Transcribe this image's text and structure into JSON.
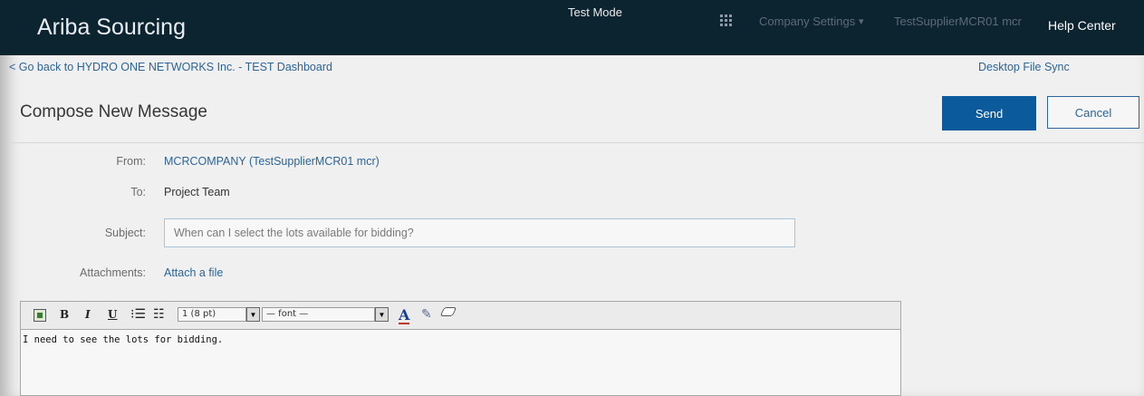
{
  "header": {
    "app_title": "Ariba Sourcing",
    "mode_label": "Test Mode",
    "apps_icon": "grid-icon",
    "company_settings": "Company Settings",
    "company_settings_caret": "▾",
    "user_name": "TestSupplierMCR01 mcr",
    "help_center": "Help Center",
    "colors": {
      "bar_bg": "#0c2330",
      "link": "#2b6597",
      "primary_button": "#0a5a9c"
    }
  },
  "nav": {
    "back_link": "< Go back to HYDRO ONE NETWORKS Inc. - TEST Dashboard",
    "desktop_sync": "Desktop File Sync"
  },
  "compose": {
    "title": "Compose New Message",
    "send_label": "Send",
    "cancel_label": "Cancel",
    "from_label": "From:",
    "from_value": "MCRCOMPANY  (TestSupplierMCR01 mcr)",
    "to_label": "To:",
    "to_value": "Project Team",
    "subject_label": "Subject:",
    "subject_placeholder": "When can I select the lots available for bidding?",
    "attachments_label": "Attachments:",
    "attach_link": "Attach a file"
  },
  "editor": {
    "toolbar": {
      "bold": "B",
      "italic": "I",
      "underline": "U",
      "ordered_list": "⁝☰",
      "unordered_list": "☷",
      "size_value": "1 (8 pt)",
      "font_value": "— font —",
      "dropdown_arrow": "▼",
      "font_color": "A",
      "highlight": "✎"
    },
    "body_text": "I need to see the lots for bidding."
  }
}
